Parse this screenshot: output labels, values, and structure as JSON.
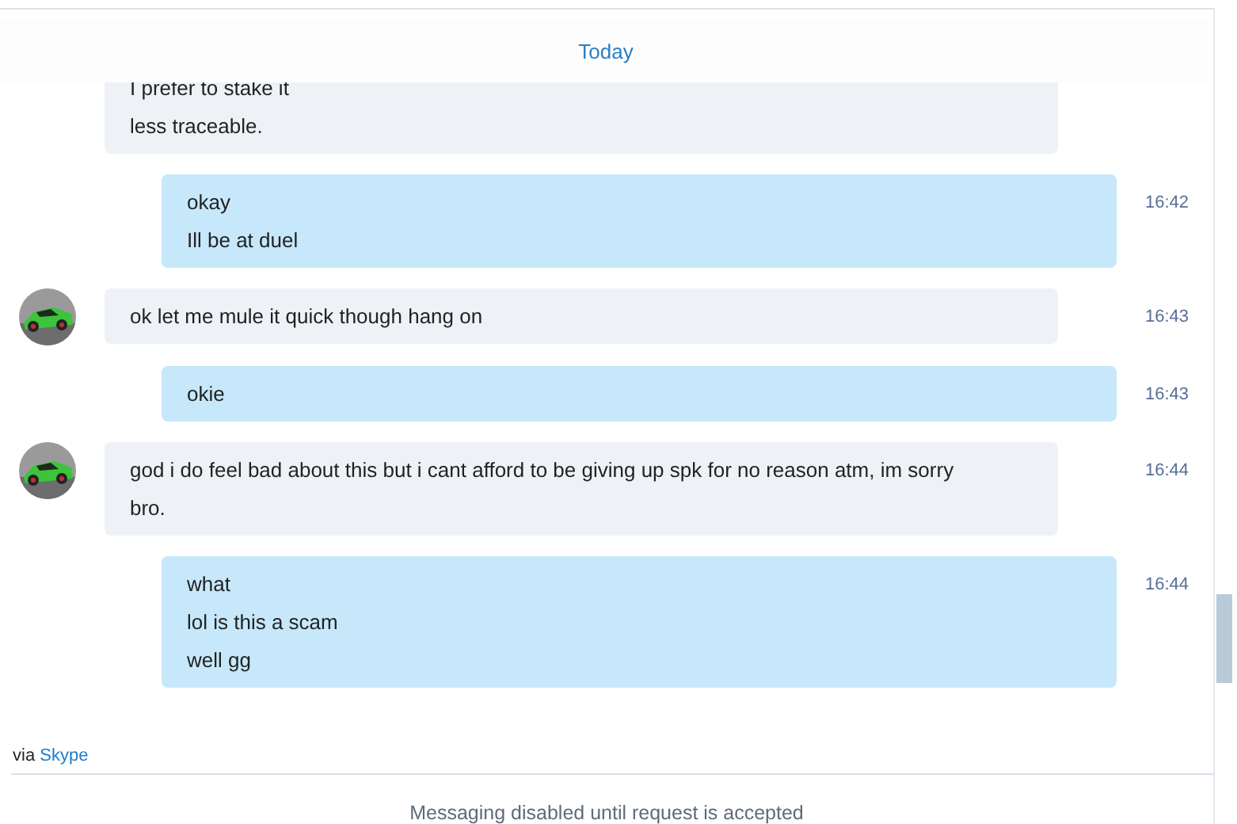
{
  "date_divider": "Today",
  "messages": [
    {
      "kind": "incoming",
      "avatar": false,
      "lines": [
        "I prefer to stake it",
        "less traceable."
      ]
    },
    {
      "kind": "outgoing",
      "lines": [
        "okay",
        "Ill be at duel"
      ],
      "time": "16:42"
    },
    {
      "kind": "incoming",
      "avatar": true,
      "lines": [
        "ok let me mule it quick though hang on"
      ],
      "time": "16:43"
    },
    {
      "kind": "outgoing",
      "lines": [
        "okie"
      ],
      "time": "16:43"
    },
    {
      "kind": "incoming",
      "avatar": true,
      "lines": [
        "god i do feel bad about this but i cant afford to be giving up spk for no reason atm, im sorry bro."
      ],
      "time": "16:44"
    },
    {
      "kind": "outgoing",
      "lines": [
        "what",
        "lol is this a scam",
        "well gg"
      ],
      "time": "16:44"
    }
  ],
  "via": {
    "prefix": "via",
    "link": "Skype"
  },
  "status": "Messaging disabled until request is accepted"
}
